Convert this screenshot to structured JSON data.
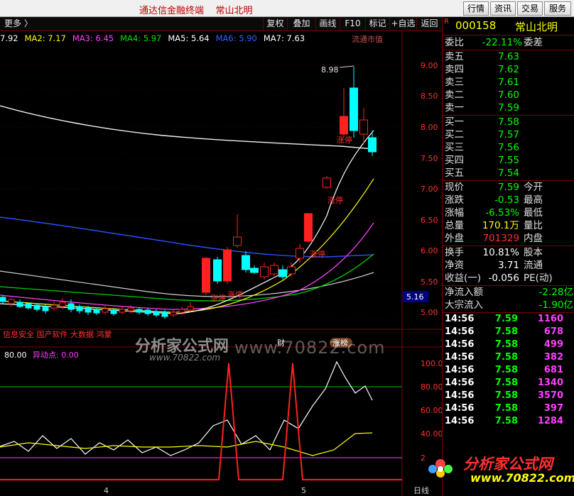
{
  "window": {
    "title": "通达信金融终端    常山北明",
    "buttons": [
      "行情",
      "资讯",
      "交易",
      "服务"
    ]
  },
  "toolbar": {
    "more": "更多 〉",
    "items": [
      "复权",
      "叠加",
      "画线",
      "F10",
      "标记",
      "+自选",
      "返回"
    ]
  },
  "ma_legend": [
    {
      "label": "7.92",
      "color": "#ffffff"
    },
    {
      "label": "MA2: 7.17",
      "color": "#ffff00"
    },
    {
      "label": "MA3: 6.45",
      "color": "#ff40ff"
    },
    {
      "label": "MA4: 5.97",
      "color": "#00e000"
    },
    {
      "label": "MA5: 5.64",
      "color": "#ffffff"
    },
    {
      "label": "MA6: 5.90",
      "color": "#3060ff"
    },
    {
      "label": "MA7: 7.63",
      "color": "#ffffff"
    }
  ],
  "main_chart": {
    "price_axis": [
      "9.00",
      "8.50",
      "8.00",
      "7.50",
      "7.00",
      "6.50",
      "6.00",
      "5.50",
      "5.00"
    ],
    "high_label": "8.98",
    "current_price_tag": "5.16",
    "mcap_label": "流通市值",
    "limit_up_labels": [
      "涨停",
      "涨停",
      "涨停",
      "涨停",
      "涨停"
    ],
    "concept_text": "信息安全 国产软件 大数据 鸿蒙",
    "news_tags": [
      "财",
      "涨榜"
    ]
  },
  "indicator": {
    "label_a": "80.00",
    "label_b": "异动点: 0.00",
    "axis": [
      "100.0",
      "80.00",
      "60.00",
      "40.00",
      "2"
    ],
    "bottom_labels": [
      "4",
      "5",
      "日线"
    ]
  },
  "stock": {
    "code": "000158",
    "name": "常山北明",
    "flag": "R"
  },
  "order_book": {
    "weibi_label": "委比",
    "weibi_value": "-22.11%",
    "weicha_label": "委差",
    "asks": [
      {
        "label": "卖五",
        "price": "7.63"
      },
      {
        "label": "卖四",
        "price": "7.62"
      },
      {
        "label": "卖三",
        "price": "7.61"
      },
      {
        "label": "卖二",
        "price": "7.60"
      },
      {
        "label": "卖一",
        "price": "7.59"
      }
    ],
    "bids": [
      {
        "label": "买一",
        "price": "7.58"
      },
      {
        "label": "买二",
        "price": "7.57"
      },
      {
        "label": "买三",
        "price": "7.56"
      },
      {
        "label": "买四",
        "price": "7.55"
      },
      {
        "label": "买五",
        "price": "7.54"
      }
    ]
  },
  "quote": [
    {
      "label": "现价",
      "value": "7.59",
      "label2": "今开"
    },
    {
      "label": "涨跌",
      "value": "-0.53",
      "label2": "最高"
    },
    {
      "label": "涨幅",
      "value": "-6.53%",
      "label2": "最低"
    },
    {
      "label": "总量",
      "value": "170.1万",
      "label2": "量比"
    },
    {
      "label": "外盘",
      "value": "701329",
      "label2": "内盘"
    }
  ],
  "fundamentals": [
    {
      "label": "换手",
      "value": "10.81%",
      "label2": "股本"
    },
    {
      "label": "净资",
      "value": "3.71",
      "label2": "流通"
    },
    {
      "label": "收益(一)",
      "value": "-0.056",
      "label2": "PE(动)"
    }
  ],
  "flows": [
    {
      "label": "净流入额",
      "value": "-2.28亿"
    },
    {
      "label": "大宗流入",
      "value": "-1.90亿"
    }
  ],
  "ticks": [
    {
      "time": "14:56",
      "price": "7.59",
      "vol": "1160"
    },
    {
      "time": "14:56",
      "price": "7.58",
      "vol": "678"
    },
    {
      "time": "14:56",
      "price": "7.58",
      "vol": "499"
    },
    {
      "time": "14:56",
      "price": "7.58",
      "vol": "382"
    },
    {
      "time": "14:56",
      "price": "7.58",
      "vol": "681"
    },
    {
      "time": "14:56",
      "price": "7.58",
      "vol": "1340"
    },
    {
      "time": "14:56",
      "price": "7.58",
      "vol": "3570"
    },
    {
      "time": "14:56",
      "price": "7.58",
      "vol": "397"
    },
    {
      "time": "14:56",
      "price": "7.58",
      "vol": "1284"
    }
  ],
  "watermark": {
    "brand": "分析家公式网",
    "url_big": "www.70822.com",
    "url_small": "www.70822.com",
    "logo_brand": "分析家公式网",
    "logo_url": "www.70822.com"
  },
  "colors": {
    "up": "#ff2020",
    "down": "#00ffff",
    "text_red": "#ff3030",
    "text_green": "#00ff00",
    "yellow": "#ffff00",
    "magenta": "#ff40ff"
  }
}
